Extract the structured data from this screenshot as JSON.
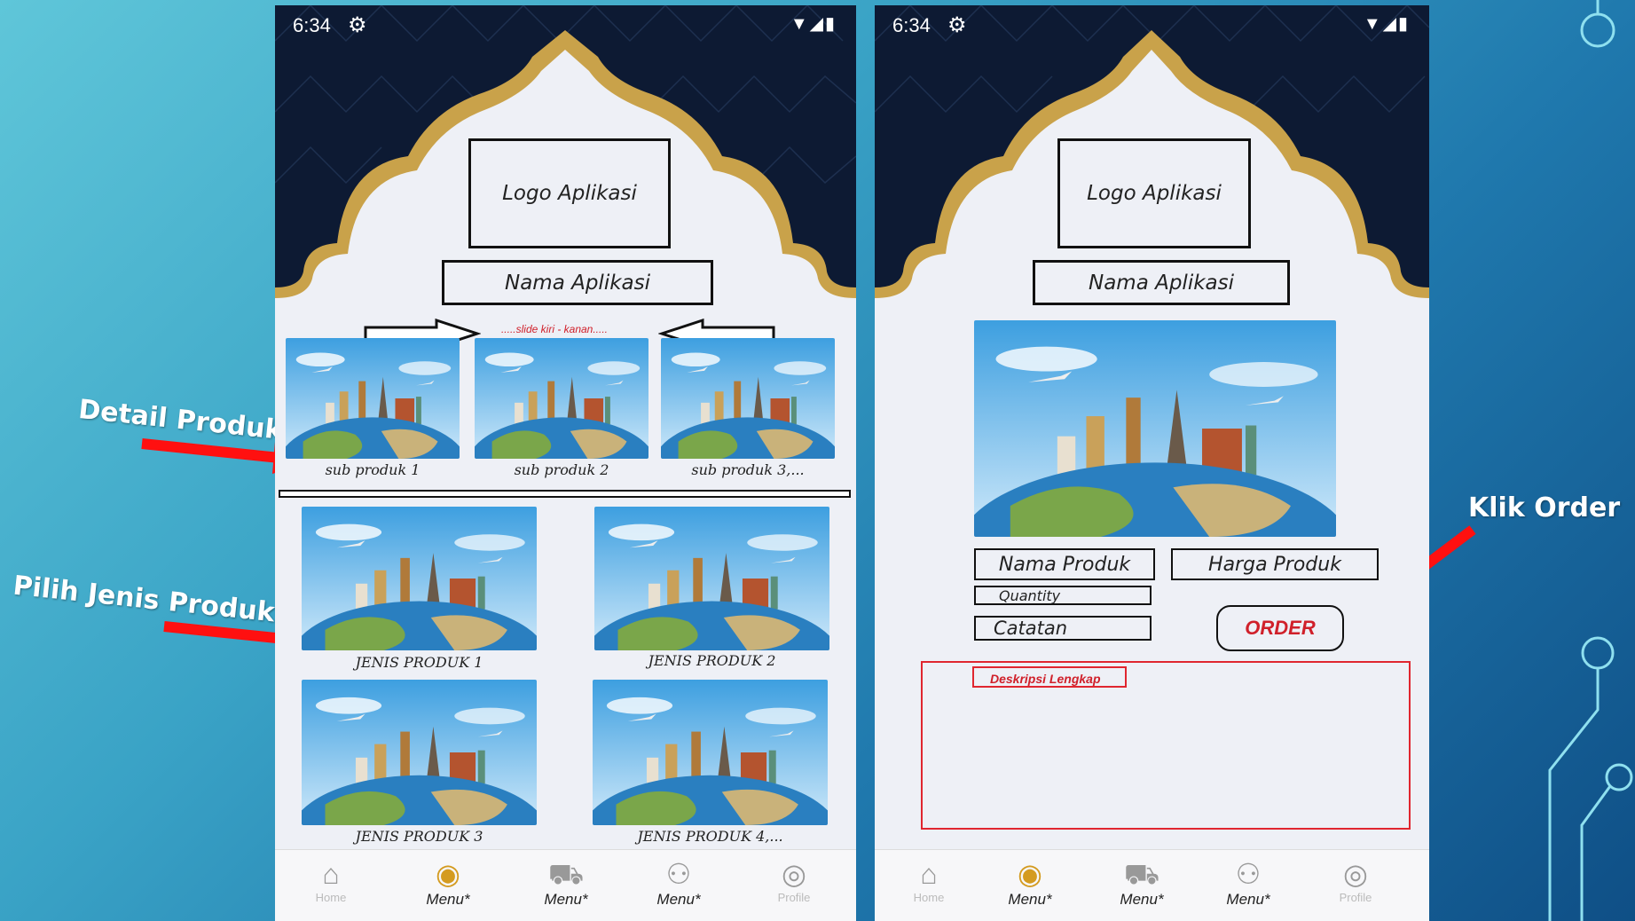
{
  "annotations": {
    "detail_produk": "Detail Produk",
    "pilih_jenis": "Pilih Jenis Produk",
    "klik_order": "Klik Order"
  },
  "left_phone": {
    "status": {
      "time": "6:34"
    },
    "logo": "Logo Aplikasi",
    "app_name": "Nama Aplikasi",
    "slide_hint": ".....slide kiri - kanan.....",
    "sub_products": [
      "sub produk 1",
      "sub produk 2",
      "sub produk 3,..."
    ],
    "product_types": [
      "JENIS PRODUK 1",
      "JENIS PRODUK 2",
      "JENIS PRODUK 3",
      "JENIS PRODUK 4,..."
    ]
  },
  "right_phone": {
    "status": {
      "time": "6:34"
    },
    "logo": "Logo Aplikasi",
    "app_name": "Nama Aplikasi",
    "product_name": "Nama Produk",
    "product_price": "Harga Produk",
    "quantity": "Quantity",
    "notes": "Catatan",
    "order_button": "ORDER",
    "description": "Deskripsi Lengkap"
  },
  "nav": {
    "home": "Home",
    "menu1": "Menu*",
    "menu2": "Menu*",
    "menu3": "Menu*",
    "profile": "Profile"
  },
  "icons": [
    "gear-icon",
    "wifi-icon",
    "signal-icon",
    "battery-icon",
    "home-icon",
    "globe-icon",
    "cart-icon",
    "group-icon",
    "profile-icon"
  ],
  "colors": {
    "accent_red": "#e0262f",
    "gold": "#c9a24a",
    "navy": "#0d1a33"
  }
}
